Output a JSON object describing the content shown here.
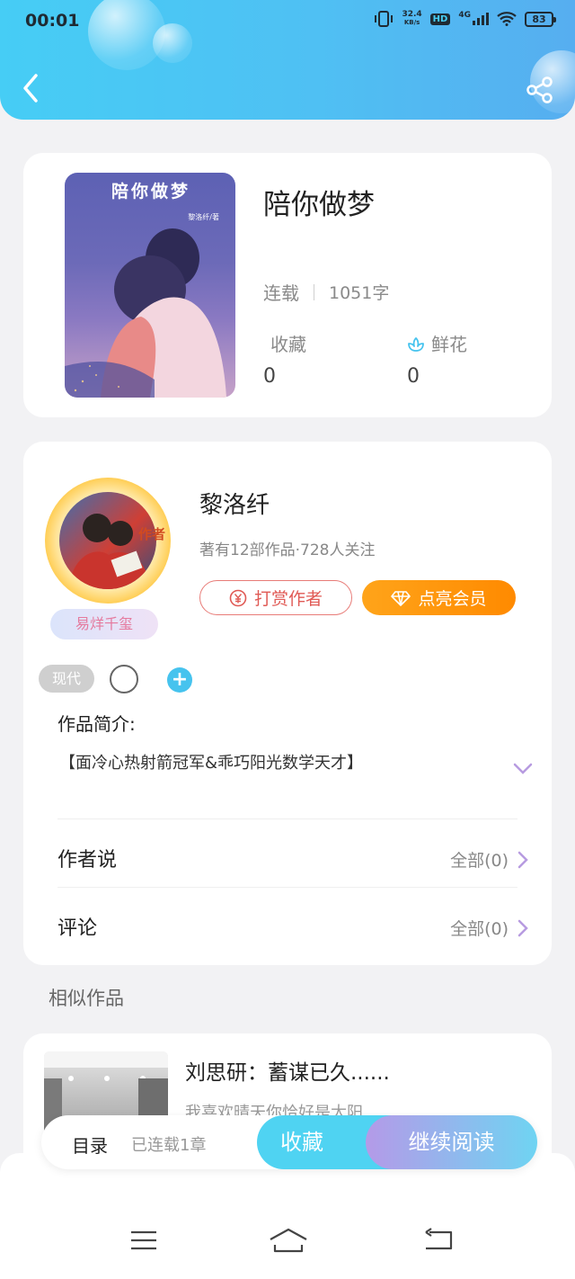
{
  "status_bar": {
    "time": "00:01",
    "net_speed_value": "32.4",
    "net_speed_unit": "KB/s",
    "hd": "HD",
    "network": "4G",
    "battery": "83"
  },
  "book": {
    "cover_title": "陪你做梦",
    "cover_author": "黎洛纤/著",
    "title": "陪你做梦",
    "status": "连载",
    "word_count": "1051字",
    "collect_label": "收藏",
    "collect_count": "0",
    "flower_label": "鲜花",
    "flower_count": "0"
  },
  "author": {
    "badge": "作者",
    "nickname_badge": "易烊千玺",
    "name": "黎洛纤",
    "subtitle": "著有12部作品·728人关注",
    "tip_button": "打赏作者",
    "vip_button": "点亮会员",
    "tag": "现代",
    "add_tag": "+",
    "synopsis_label": "作品简介:",
    "synopsis": "【面冷心热射箭冠军&乖巧阳光数学天才】",
    "author_says_label": "作者说",
    "author_says_link": "全部(0)",
    "comments_label": "评论",
    "comments_link": "全部(0)"
  },
  "similar": {
    "section_title": "相似作品",
    "items": [
      {
        "title": "刘思研：蓄谋已久......",
        "desc": "我喜欢晴天你恰好是太阳"
      }
    ]
  },
  "action_bar": {
    "toc_label": "目录",
    "toc_status": "已连载1章",
    "collect_button": "收藏",
    "read_button": "继续阅读"
  },
  "colors": {
    "header_gradient_start": "#46cdf5",
    "accent_blue": "#4fd3f2",
    "tip_red": "#e05a55",
    "vip_orange": "#ff8a00",
    "chevron_purple": "#b79be0"
  },
  "icons": [
    "back-arrow-icon",
    "share-icon",
    "flower-icon",
    "yuan-coin-icon",
    "diamond-icon",
    "chevron-down-icon",
    "chevron-right-icon",
    "menu-icon",
    "home-icon",
    "return-icon"
  ]
}
